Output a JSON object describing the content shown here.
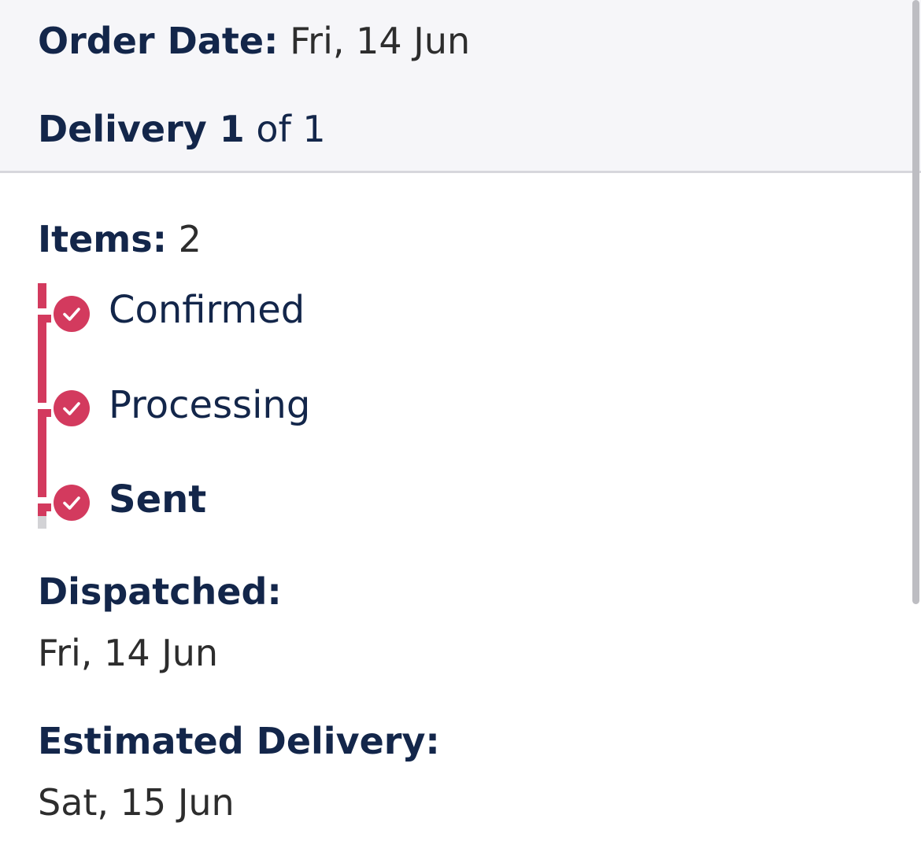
{
  "order": {
    "date_label": "Order Date:",
    "date_value": "Fri, 14 Jun",
    "delivery_label": "Delivery 1",
    "delivery_of": "of 1"
  },
  "items": {
    "label": "Items:",
    "count": "2"
  },
  "timeline": {
    "steps": [
      {
        "label": "Confirmed",
        "status": "complete",
        "icon": "check-circle-icon"
      },
      {
        "label": "Processing",
        "status": "complete",
        "icon": "check-circle-icon"
      },
      {
        "label": "Sent",
        "status": "current",
        "icon": "check-circle-icon"
      }
    ],
    "accent_color": "#d33a5e"
  },
  "dispatched": {
    "label": "Dispatched:",
    "value": "Fri, 14 Jun"
  },
  "estimated_delivery": {
    "label": "Estimated Delivery:",
    "value": "Sat, 15 Jun"
  }
}
